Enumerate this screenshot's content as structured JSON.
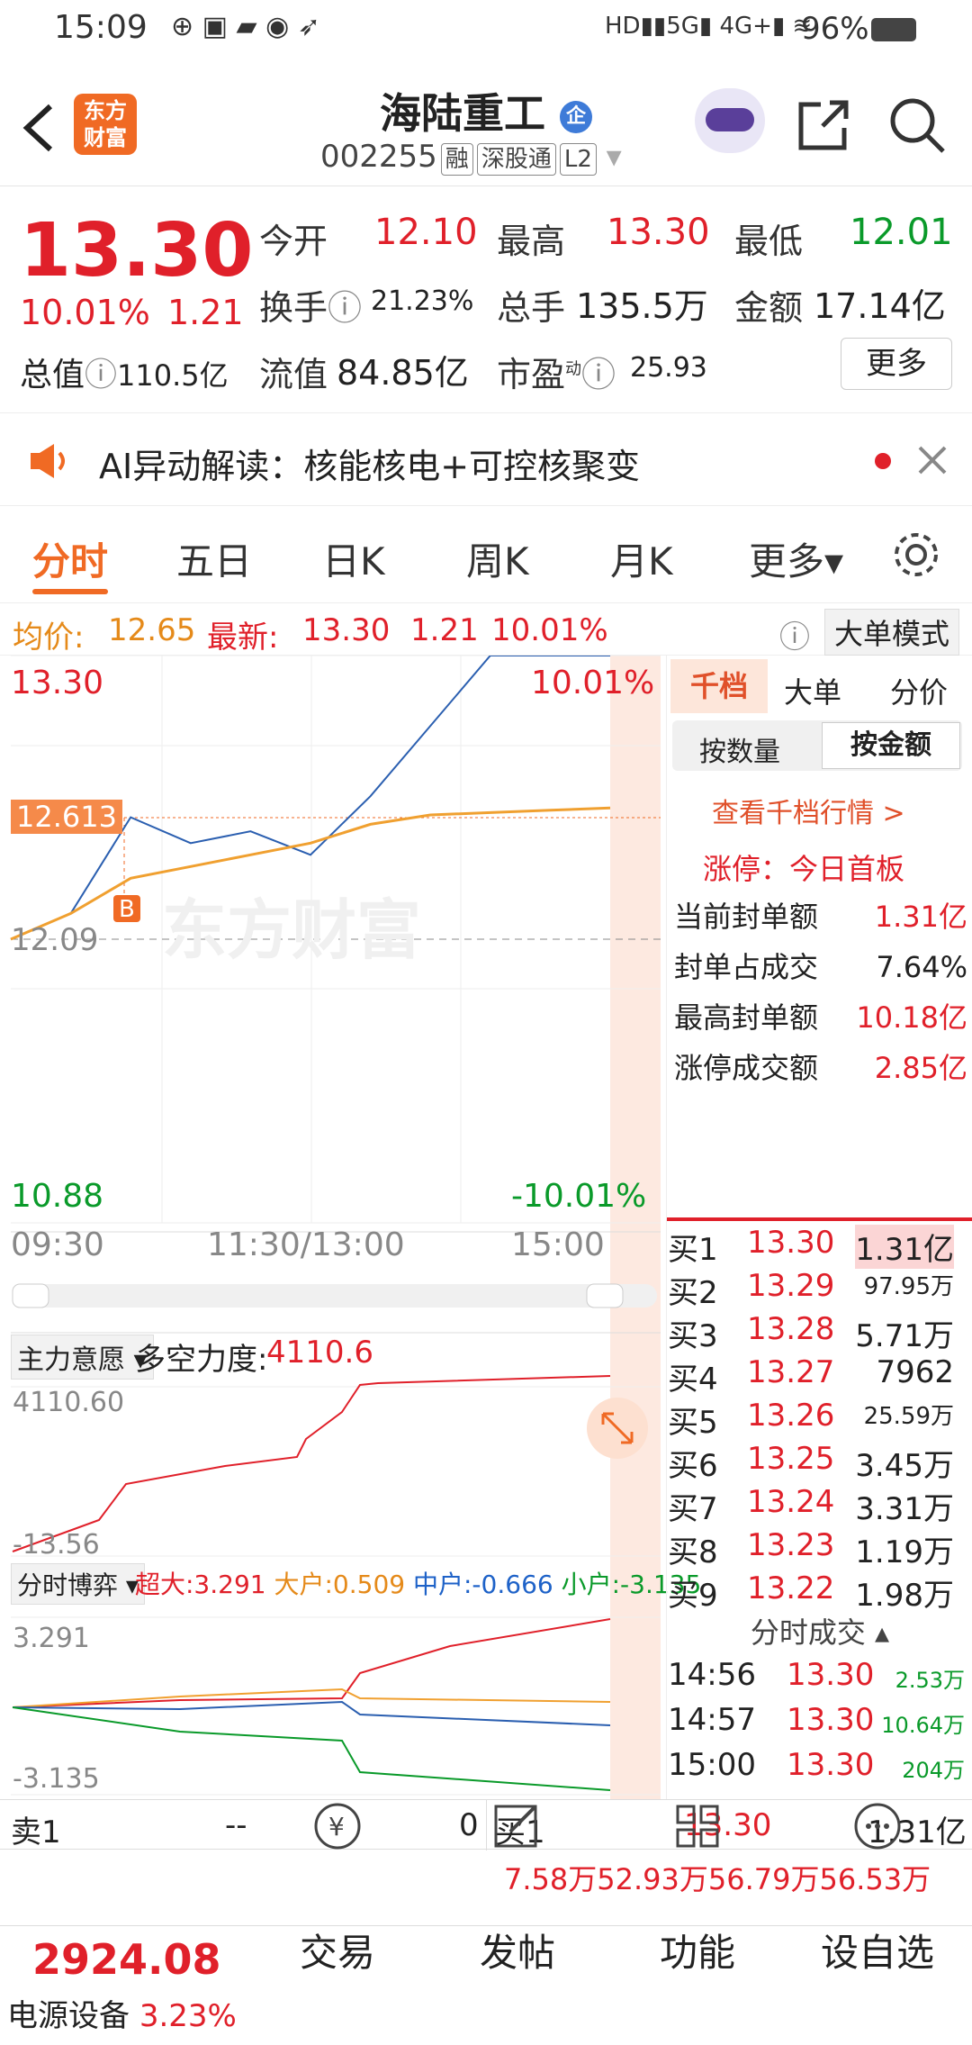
{
  "status": {
    "time": "15:09",
    "battery": "96%",
    "net1": "5G",
    "net2": "4G+"
  },
  "header": {
    "logo": "东方\n财富",
    "name": "海陆重工",
    "badge": "企",
    "code": "002255",
    "tags": [
      "融",
      "深股通",
      "L2"
    ]
  },
  "quote": {
    "price": "13.30",
    "pct": "10.01%",
    "chg": "1.21",
    "open_label": "今开",
    "open": "12.10",
    "high_label": "最高",
    "high": "13.30",
    "low_label": "最低",
    "low": "12.01",
    "turnover_label": "换手",
    "turnover": "21.23%",
    "vol_label": "总手",
    "vol": "135.5万",
    "amt_label": "金额",
    "amt": "17.14亿",
    "mcap_label": "总值",
    "mcap": "110.5亿",
    "float_label": "流值",
    "float": "84.85亿",
    "pe_label": "市盈",
    "pe_sup": "动",
    "pe": "25.93",
    "more": "更多"
  },
  "ai": {
    "text": "AI异动解读：核能核电+可控核聚变"
  },
  "tabs": [
    "分时",
    "五日",
    "日K",
    "周K",
    "月K",
    "更多▾"
  ],
  "info": {
    "avg_label": "均价:",
    "avg": "12.65",
    "latest_label": "最新:",
    "latest": "13.30",
    "chg": "1.21",
    "pct": "10.01%",
    "mode": "大单模式"
  },
  "chart": {
    "top": "13.30",
    "top_pct": "10.01%",
    "bottom": "10.88",
    "bottom_pct": "-10.01%",
    "cursor": "12.613",
    "prev_close": "12.09",
    "buy_mark": "B",
    "watermark": "东方财富",
    "times": [
      "09:30",
      "11:30/13:00",
      "15:00"
    ],
    "scroll_left": "|||",
    "scroll_right": "|||"
  },
  "right": {
    "tabs": [
      "千档",
      "大单",
      "分价"
    ],
    "sub": [
      "按数量",
      "按金额"
    ],
    "link": "查看千档行情 >",
    "limit_title": "涨停：今日首板",
    "stats": [
      {
        "label": "当前封单额",
        "value": "1.31亿"
      },
      {
        "label": "封单占成交",
        "value": "7.64%"
      },
      {
        "label": "最高封单额",
        "value": "10.18亿"
      },
      {
        "label": "涨停成交额",
        "value": "2.85亿"
      }
    ]
  },
  "orderbook": [
    {
      "l": "买1",
      "p": "13.30",
      "v": "1.31亿"
    },
    {
      "l": "买2",
      "p": "13.29",
      "v": "97.95万"
    },
    {
      "l": "买3",
      "p": "13.28",
      "v": "5.71万"
    },
    {
      "l": "买4",
      "p": "13.27",
      "v": "7962"
    },
    {
      "l": "买5",
      "p": "13.26",
      "v": "25.59万"
    },
    {
      "l": "买6",
      "p": "13.25",
      "v": "3.45万"
    },
    {
      "l": "买7",
      "p": "13.24",
      "v": "3.31万"
    },
    {
      "l": "买8",
      "p": "13.23",
      "v": "1.19万"
    },
    {
      "l": "买9",
      "p": "13.22",
      "v": "1.98万"
    }
  ],
  "ticks": {
    "title": "分时成交 ▴",
    "rows": [
      {
        "t": "14:56",
        "p": "13.30",
        "v": "2.53万"
      },
      {
        "t": "14:57",
        "p": "13.30",
        "v": "10.64万"
      },
      {
        "t": "15:00",
        "p": "13.30",
        "v": "204万"
      }
    ]
  },
  "ind1": {
    "name": "主力意愿 ▾",
    "label": "多空力度:",
    "value": "4110.6",
    "max": "4110.60",
    "min": "-13.56"
  },
  "ind2": {
    "name": "分时博弈 ▾",
    "s1": "超大:3.291",
    "s2": "大户:0.509",
    "s3": "中户:-0.666",
    "s4": "小户:-3.135",
    "max": "3.291",
    "min": "-3.135"
  },
  "book_bottom": {
    "sell_label": "卖1",
    "sell_p": "--",
    "sell_v": "0",
    "buy_label": "买1",
    "buy_p": "13.30",
    "buy_v": "1.31亿",
    "row2": [
      "7.58万",
      "52.93万",
      "56.79万",
      "56.53万"
    ]
  },
  "bottom": {
    "index_val": "2924.08",
    "index_name": "电源设备",
    "index_pct": "3.23%",
    "nav": [
      "交易",
      "发帖",
      "功能",
      "设自选"
    ]
  },
  "chart_data": {
    "type": "line",
    "x": [
      "09:30",
      "11:30/13:00",
      "15:00"
    ],
    "ylim": [
      10.88,
      13.3
    ],
    "series": [
      {
        "name": "",
        "values": [
          12.09,
          12.2,
          12.61,
          12.5,
          12.55,
          12.45,
          12.7,
          13.0,
          13.3,
          13.3,
          13.3
        ]
      },
      {
        "name": "均价",
        "values": [
          12.09,
          12.2,
          12.35,
          12.4,
          12.45,
          12.5,
          12.58,
          12.62,
          12.63,
          12.64,
          12.65
        ]
      }
    ]
  }
}
